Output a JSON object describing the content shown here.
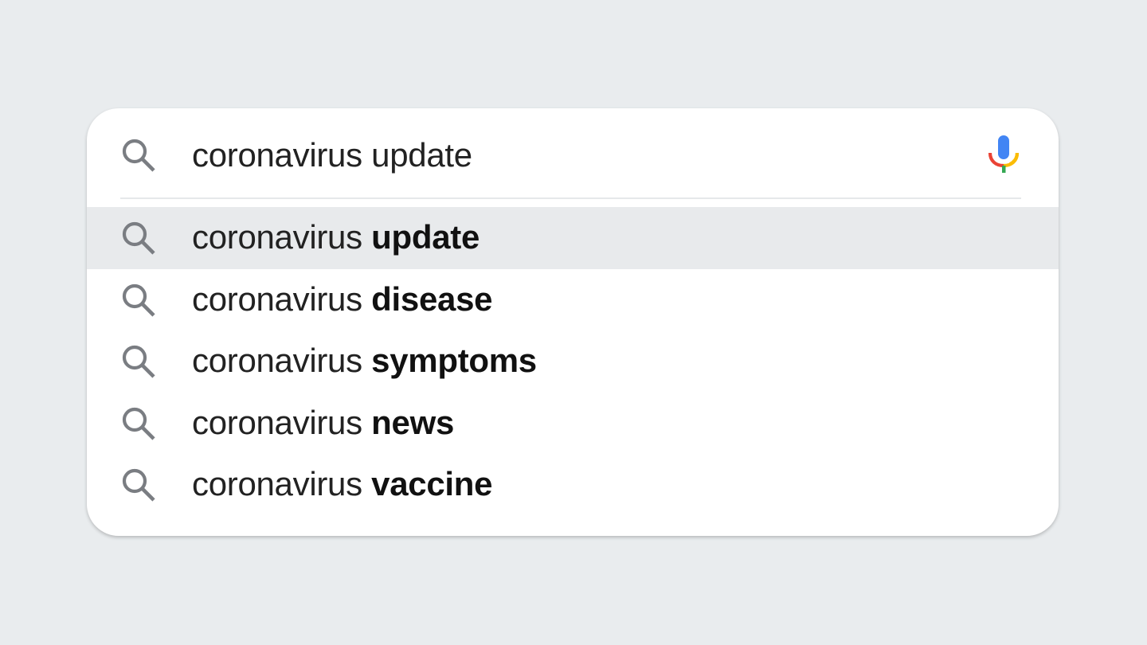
{
  "search": {
    "query": "coronavirus update",
    "icon": "search-icon",
    "voice_icon": "microphone-icon"
  },
  "suggestions": [
    {
      "prefix": "coronavirus ",
      "completion": "update",
      "active": true
    },
    {
      "prefix": "coronavirus ",
      "completion": "disease",
      "active": false
    },
    {
      "prefix": "coronavirus ",
      "completion": "symptoms",
      "active": false
    },
    {
      "prefix": "coronavirus ",
      "completion": "news",
      "active": false
    },
    {
      "prefix": "coronavirus ",
      "completion": "vaccine",
      "active": false
    }
  ],
  "colors": {
    "background": "#e9ecee",
    "card": "#ffffff",
    "highlight": "#e8eaec",
    "icon": "#7a7d82",
    "mic_blue": "#4285f4",
    "mic_red": "#ea4335",
    "mic_yellow": "#fbbc05",
    "mic_green": "#34a853"
  }
}
